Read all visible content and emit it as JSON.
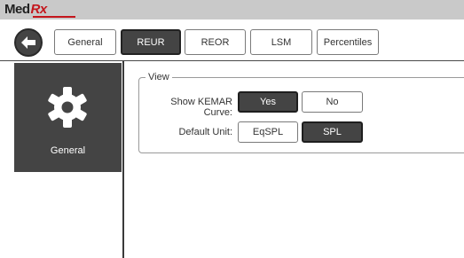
{
  "logo": {
    "part1": "Med",
    "part2": "Rx"
  },
  "nav": {
    "back_icon": "arrow-left-icon",
    "tabs": [
      {
        "label": "General",
        "active": false
      },
      {
        "label": "REUR",
        "active": true
      },
      {
        "label": "REOR",
        "active": false
      },
      {
        "label": "LSM",
        "active": false
      },
      {
        "label": "Percentiles",
        "active": false
      }
    ]
  },
  "sidebar": {
    "items": [
      {
        "label": "General",
        "icon": "gear-icon",
        "active": true
      }
    ]
  },
  "view": {
    "title": "View",
    "kemar": {
      "label": "Show KEMAR Curve:",
      "options": [
        "Yes",
        "No"
      ],
      "selected": "Yes"
    },
    "unit": {
      "label": "Default Unit:",
      "options": [
        "EqSPL",
        "SPL"
      ],
      "selected": "SPL"
    }
  },
  "colors": {
    "accent": "#444444",
    "brand_red": "#c4161c",
    "titlebar": "#c9c9c9"
  }
}
